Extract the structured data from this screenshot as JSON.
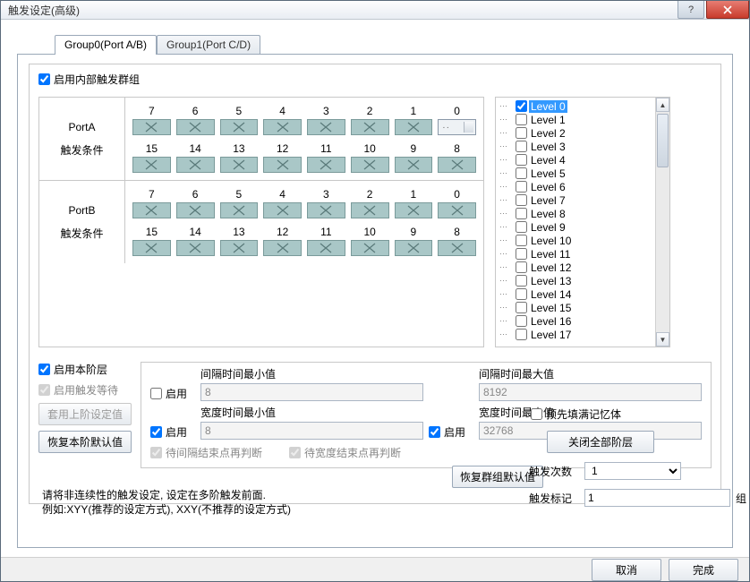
{
  "window": {
    "title": "触发设定(高级)"
  },
  "tabs": [
    {
      "label": "Group0(Port A/B)",
      "active": true
    },
    {
      "label": "Group1(Port C/D)",
      "active": false
    }
  ],
  "enable_group_label": "启用内部触发群组",
  "ports": {
    "a": {
      "name": "PortA",
      "cond": "触发条件"
    },
    "b": {
      "name": "PortB",
      "cond": "触发条件"
    },
    "bits_hi": [
      "7",
      "6",
      "5",
      "4",
      "3",
      "2",
      "1",
      "0"
    ],
    "bits_lo": [
      "15",
      "14",
      "13",
      "12",
      "11",
      "10",
      "9",
      "8"
    ]
  },
  "levels": {
    "items": [
      "Level 0",
      "Level 1",
      "Level 2",
      "Level 3",
      "Level 4",
      "Level 5",
      "Level 6",
      "Level 7",
      "Level 8",
      "Level 9",
      "Level 10",
      "Level 11",
      "Level 12",
      "Level 13",
      "Level 14",
      "Level 15",
      "Level 16",
      "Level 17"
    ],
    "checked_index": 0,
    "selected_index": 0
  },
  "lower_left": {
    "enable_level": "启用本阶层",
    "enable_wait": "启用触发等待",
    "apply_prev": "套用上阶设定值",
    "restore_level": "恢复本阶默认值"
  },
  "fields": {
    "interval_min_label": "间隔时间最小值",
    "interval_min_value": "8",
    "interval_max_label": "间隔时间最大值",
    "interval_max_value": "8192",
    "width_min_label": "宽度时间最小值",
    "width_min_value": "8",
    "width_max_label": "宽度时间最大值",
    "width_max_value": "32768",
    "enable_cb": "启用",
    "wait_interval_end": "待间隔结束点再判断",
    "wait_width_end": "待宽度结束点再判断"
  },
  "right": {
    "prefill": "预先填满记忆体",
    "close_all": "关闭全部阶层",
    "trigger_count_label": "触发次数",
    "trigger_count_value": "1",
    "trigger_mark_label": "触发标记",
    "trigger_mark_value": "1",
    "trigger_mark_suffix": "组"
  },
  "restore_group": "恢复群组默认值",
  "hint_line1": "请将非连续性的触发设定, 设定在多阶触发前面.",
  "hint_line2": "例如:XYY(推荐的设定方式), XXY(不推荐的设定方式)",
  "footer": {
    "cancel": "取消",
    "finish": "完成"
  }
}
